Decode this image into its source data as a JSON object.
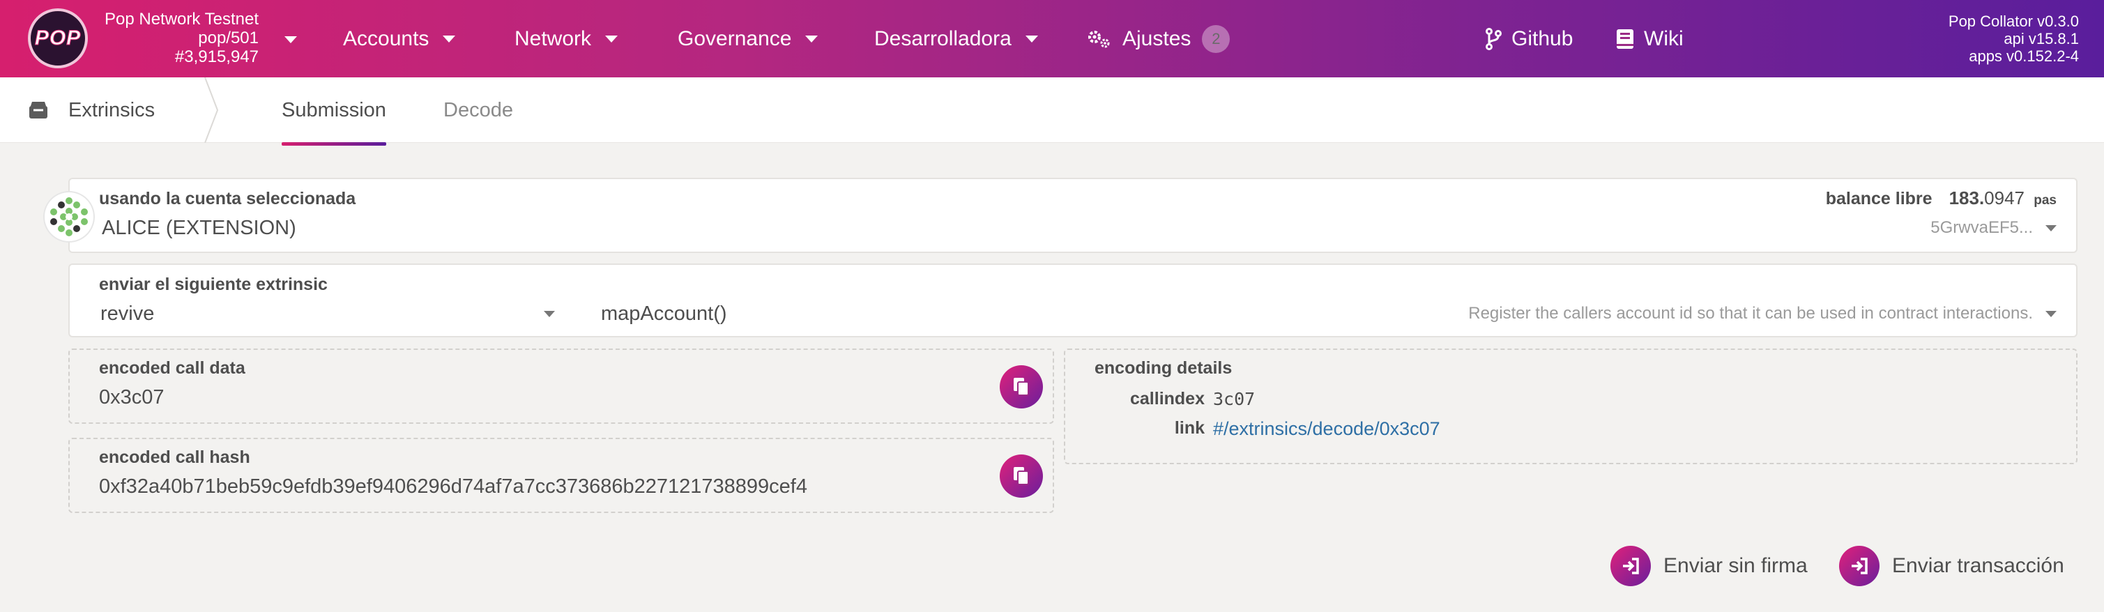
{
  "header": {
    "logo_text": "POP",
    "chain_name": "Pop Network Testnet",
    "chain_spec": "pop/501",
    "block_number": "#3,915,947",
    "menu": [
      {
        "label": "Accounts",
        "icon": "chevron-down-icon"
      },
      {
        "label": "Network",
        "icon": "chevron-down-icon"
      },
      {
        "label": "Governance",
        "icon": "chevron-down-icon"
      },
      {
        "label": "Desarrolladora",
        "icon": "chevron-down-icon"
      },
      {
        "label": "Ajustes",
        "icon": "gears-icon",
        "badge": "2"
      }
    ],
    "links": [
      {
        "label": "Github",
        "icon": "git-branch-icon"
      },
      {
        "label": "Wiki",
        "icon": "book-icon"
      }
    ],
    "version": {
      "node": "Pop Collator v0.3.0",
      "api": "api v15.8.1",
      "apps": "apps v0.152.2-4"
    }
  },
  "subnav": {
    "section": "Extrinsics",
    "section_icon": "envelope-icon",
    "tabs": [
      "Submission",
      "Decode"
    ],
    "active_tab": "Submission"
  },
  "account": {
    "label": "usando la cuenta seleccionada",
    "name": "ALICE (EXTENSION)",
    "balance_label": "balance libre",
    "balance_int": "183.",
    "balance_dec": "0947",
    "balance_unit": "pas",
    "address": "5GrwvaEF5..."
  },
  "extrinsic": {
    "label": "enviar el siguiente extrinsic",
    "pallet": "revive",
    "method": "mapAccount()",
    "description": "Register the callers account id so that it can be used in contract interactions."
  },
  "encoded": {
    "call_data_label": "encoded call data",
    "call_data": "0x3c07",
    "call_hash_label": "encoded call hash",
    "call_hash": "0xf32a40b71beb59c9efdb39ef9406296d74af7a7cc373686b227121738899cef4",
    "details_label": "encoding details",
    "callindex_label": "callindex",
    "callindex": "3c07",
    "link_label": "link",
    "link": "#/extrinsics/decode/0x3c07"
  },
  "actions": {
    "unsigned": "Enviar sin firma",
    "submit": "Enviar transacción"
  },
  "colors": {
    "accent_start": "#d61f6e",
    "accent_end": "#5a1e9c",
    "link": "#2e6fa5"
  }
}
